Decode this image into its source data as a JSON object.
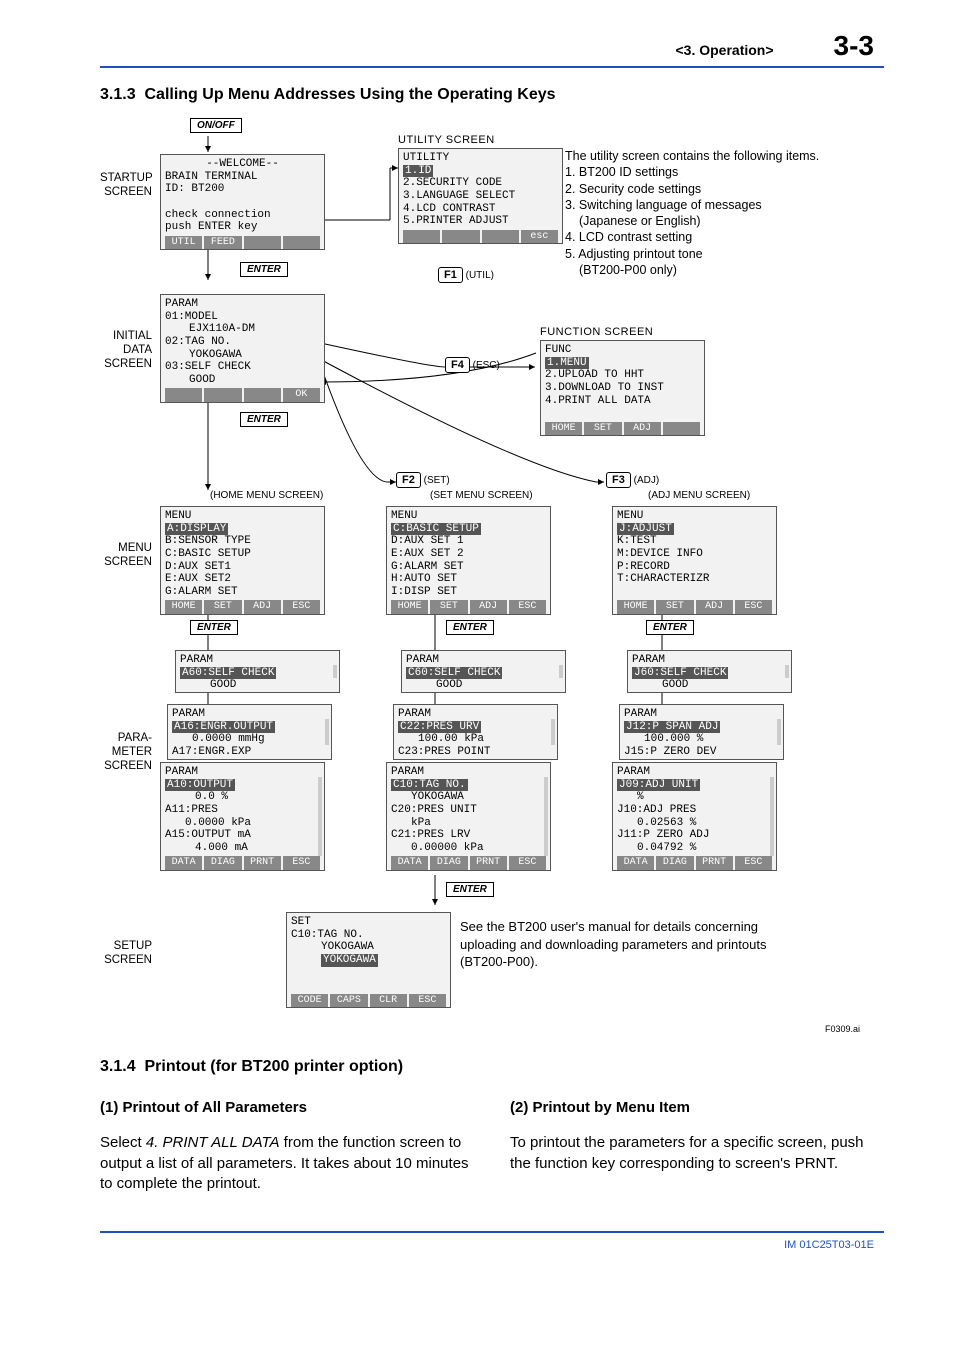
{
  "header": {
    "chapter": "<3.  Operation>",
    "page": "3-3"
  },
  "section313": {
    "num": "3.1.3",
    "title": "Calling Up Menu Addresses Using the Operating Keys"
  },
  "diagram": {
    "onoff": "ON/OFF",
    "side": {
      "startup": "STARTUP SCREEN",
      "initial": "INITIAL DATA SCREEN",
      "menu": "MENU SCREEN",
      "para": "PARA- METER SCREEN",
      "setup": "SETUP SCREEN"
    },
    "startup": {
      "l1": "--WELCOME--",
      "l2": "BRAIN TERMINAL",
      "l3": "ID:  BT200",
      "l4": "check connection",
      "l5": "push ENTER key",
      "k1": "UTIL",
      "k2": "FEED"
    },
    "utility_title": "UTILITY SCREEN",
    "utility": {
      "t": "UTILITY",
      "r1": "1.ID",
      "r2": "2.SECURITY CODE",
      "r3": "3.LANGUAGE SELECT",
      "r4": "4.LCD CONTRAST",
      "r5": "5.PRINTER ADJUST",
      "esc": "esc"
    },
    "utility_desc": {
      "l0": "The utility screen contains the following items.",
      "l1": "1. BT200 ID settings",
      "l2": "2. Security code settings",
      "l3": "3. Switching language of messages",
      "l3b": "(Japanese or English)",
      "l4": "4. LCD contrast setting",
      "l5": "5. Adjusting printout tone",
      "l5b": "(BT200-P00 only)"
    },
    "f1": "F1",
    "f1_lbl": "(UTIL)",
    "f4": "F4",
    "f4_lbl": "(ESC)",
    "f2": "F2",
    "f2_lbl": "(SET)",
    "f3": "F3",
    "f3_lbl": "(ADJ)",
    "enter": "ENTER",
    "func_title": "FUNCTION SCREEN",
    "func": {
      "t": "FUNC",
      "r1": "1.MENU",
      "r2": "2.UPLOAD TO HHT",
      "r3": "3.DOWNLOAD TO INST",
      "r4": "4.PRINT ALL DATA",
      "k1": "HOME",
      "k2": "SET",
      "k3": "ADJ"
    },
    "initial": {
      "t": "PARAM",
      "r1": "01:MODEL",
      "r1v": "EJX110A-DM",
      "r2": "02:TAG NO.",
      "r2v": "YOKOGAWA",
      "r3": "03:SELF CHECK",
      "r3v": "GOOD",
      "ok": "OK"
    },
    "home_title": "(HOME MENU SCREEN)",
    "set_title": "(SET MENU SCREEN)",
    "adj_title": "(ADJ MENU SCREEN)",
    "home_menu": {
      "t": "MENU",
      "rA": "A:DISPLAY",
      "rB": "B:SENSOR TYPE",
      "rC": "C:BASIC SETUP",
      "rD": "D:AUX SET1",
      "rE": "E:AUX SET2",
      "rG": "G:ALARM SET",
      "k1": "HOME",
      "k2": "SET",
      "k3": "ADJ",
      "k4": "ESC"
    },
    "set_menu": {
      "t": "MENU",
      "rC": "C:BASIC SETUP",
      "rD": "D:AUX SET 1",
      "rE": "E:AUX SET 2",
      "rG": "G:ALARM SET",
      "rH": "H:AUTO SET",
      "rI": "I:DISP SET",
      "k1": "HOME",
      "k2": "SET",
      "k3": "ADJ",
      "k4": "ESC"
    },
    "adj_menu": {
      "t": "MENU",
      "rJ": "J:ADJUST",
      "rK": "K:TEST",
      "rM": "M:DEVICE INFO",
      "rP": "P:RECORD",
      "rT": "T:CHARACTERIZR",
      "k1": "HOME",
      "k2": "SET",
      "k3": "ADJ",
      "k4": "ESC"
    },
    "param_a60": {
      "t": "PARAM",
      "r1": "A60:SELF CHECK",
      "r1v": "GOOD"
    },
    "param_c60": {
      "t": "PARAM",
      "r1": "C60:SELF CHECK",
      "r1v": "GOOD"
    },
    "param_j60": {
      "t": "PARAM",
      "r1": "J60:SELF CHECK",
      "r1v": "GOOD"
    },
    "param_a16": {
      "t": "PARAM",
      "r1": "A16:ENGR.OUTPUT",
      "r1v": "0.0000 mmHg",
      "r2": "A17:ENGR.EXP"
    },
    "param_c22": {
      "t": "PARAM",
      "r1": "C22:PRES URV",
      "r1v": "100.00 kPa",
      "r2": "C23:PRES POINT"
    },
    "param_j12": {
      "t": "PARAM",
      "r1": "J12:P SPAN ADJ",
      "r1v": "100.000 %",
      "r2": "J15:P ZERO DEV"
    },
    "param_a10": {
      "t": "PARAM",
      "r1": "A10:OUTPUT",
      "r1v": "0.0 %",
      "r2": "A11:PRES",
      "r2v": "0.0000 kPa",
      "r3": "A15:OUTPUT mA",
      "r3v": "4.000 mA",
      "k1": "DATA",
      "k2": "DIAG",
      "k3": "PRNT",
      "k4": "ESC"
    },
    "param_c10": {
      "t": "PARAM",
      "r1": "C10:TAG NO.",
      "r1v": "YOKOGAWA",
      "r2": "C20:PRES UNIT",
      "r2v": "kPa",
      "r3": "C21:PRES LRV",
      "r3v": "0.00000 kPa",
      "k1": "DATA",
      "k2": "DIAG",
      "k3": "PRNT",
      "k4": "ESC"
    },
    "param_j09": {
      "t": "PARAM",
      "r1": "J09:ADJ UNIT",
      "r1v": "%",
      "r2": "J10:ADJ PRES",
      "r2v": "0.02563 %",
      "r3": "J11:P ZERO ADJ",
      "r3v": "0.04792 %",
      "k1": "DATA",
      "k2": "DIAG",
      "k3": "PRNT",
      "k4": "ESC"
    },
    "setup": {
      "t": "SET",
      "r1": "C10:TAG NO.",
      "r1v": "YOKOGAWA",
      "r2v": "YOKOGAWA",
      "k1": "CODE",
      "k2": "CAPS",
      "k3": "CLR",
      "k4": "ESC"
    },
    "note": "See the BT200 user's manual for details concerning uploading and downloading parameters and printouts (BT200-P00).",
    "figref": "F0309.ai"
  },
  "section314": {
    "num": "3.1.4",
    "title": "Printout (for BT200 printer option)",
    "p1_h": "(1)   Printout of All Parameters",
    "p1_t1": "Select ",
    "p1_em": "4. PRINT ALL DATA",
    "p1_t2": " from the function screen to output a list of all parameters. It takes about 10 minutes to complete the printout.",
    "p2_h": "(2)   Printout by Menu Item",
    "p2_t": "To printout the parameters for a specific screen, push the function key corresponding to screen's PRNT."
  },
  "footer": "IM 01C25T03-01E"
}
